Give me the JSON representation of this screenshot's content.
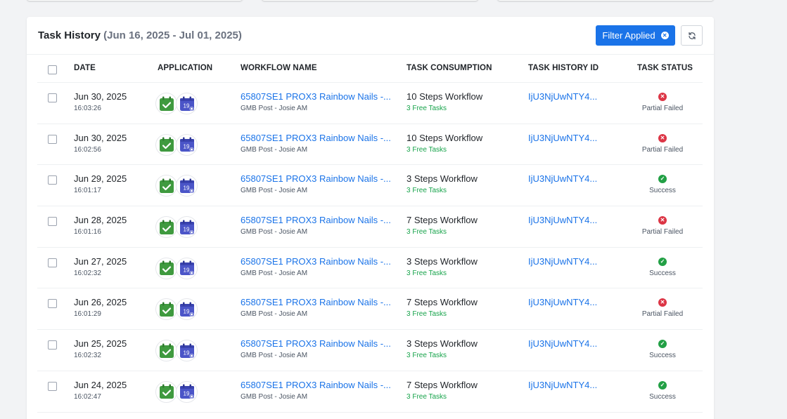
{
  "header": {
    "title": "Task History",
    "date_range": "(Jun 16, 2025 - Jul 01, 2025)",
    "filter_label": "Filter Applied"
  },
  "columns": {
    "date": "DATE",
    "application": "APPLICATION",
    "workflow_name": "WORKFLOW NAME",
    "task_consumption": "TASK CONSUMPTION",
    "task_history_id": "TASK HISTORY ID",
    "task_status": "TASK STATUS"
  },
  "colors": {
    "accent": "#1a73e8",
    "success": "#22a045",
    "failed": "#dc3545",
    "free_tasks": "#16a34a",
    "app_green": "#3f9a3f",
    "app_indigo": "#4b55c8"
  },
  "icons": [
    "close-circle-icon",
    "refresh-icon",
    "calendar-check-icon",
    "calendar-day-icon",
    "fail-x-icon",
    "success-check-icon"
  ],
  "rows": [
    {
      "date": "Jun 30, 2025",
      "time": "16:03:26",
      "workflow": "65807SE1 PROX3 Rainbow Nails -...",
      "workflow_sub": "GMB Post - Josie AM",
      "consumption": "10 Steps Workflow",
      "free": "3 Free Tasks",
      "history_id": "IjU3NjUwNTY4...",
      "status": "Partial Failed",
      "ok": false,
      "cal_day": "19"
    },
    {
      "date": "Jun 30, 2025",
      "time": "16:02:56",
      "workflow": "65807SE1 PROX3 Rainbow Nails -...",
      "workflow_sub": "GMB Post - Josie AM",
      "consumption": "10 Steps Workflow",
      "free": "3 Free Tasks",
      "history_id": "IjU3NjUwNTY4...",
      "status": "Partial Failed",
      "ok": false,
      "cal_day": "19"
    },
    {
      "date": "Jun 29, 2025",
      "time": "16:01:17",
      "workflow": "65807SE1 PROX3 Rainbow Nails -...",
      "workflow_sub": "GMB Post - Josie AM",
      "consumption": "3 Steps Workflow",
      "free": "3 Free Tasks",
      "history_id": "IjU3NjUwNTY4...",
      "status": "Success",
      "ok": true,
      "cal_day": "19"
    },
    {
      "date": "Jun 28, 2025",
      "time": "16:01:16",
      "workflow": "65807SE1 PROX3 Rainbow Nails -...",
      "workflow_sub": "GMB Post - Josie AM",
      "consumption": "7 Steps Workflow",
      "free": "3 Free Tasks",
      "history_id": "IjU3NjUwNTY4...",
      "status": "Partial Failed",
      "ok": false,
      "cal_day": "19"
    },
    {
      "date": "Jun 27, 2025",
      "time": "16:02:32",
      "workflow": "65807SE1 PROX3 Rainbow Nails -...",
      "workflow_sub": "GMB Post - Josie AM",
      "consumption": "3 Steps Workflow",
      "free": "3 Free Tasks",
      "history_id": "IjU3NjUwNTY4...",
      "status": "Success",
      "ok": true,
      "cal_day": "19"
    },
    {
      "date": "Jun 26, 2025",
      "time": "16:01:29",
      "workflow": "65807SE1 PROX3 Rainbow Nails -...",
      "workflow_sub": "GMB Post - Josie AM",
      "consumption": "7 Steps Workflow",
      "free": "3 Free Tasks",
      "history_id": "IjU3NjUwNTY4...",
      "status": "Partial Failed",
      "ok": false,
      "cal_day": "19"
    },
    {
      "date": "Jun 25, 2025",
      "time": "16:02:32",
      "workflow": "65807SE1 PROX3 Rainbow Nails -...",
      "workflow_sub": "GMB Post - Josie AM",
      "consumption": "3 Steps Workflow",
      "free": "3 Free Tasks",
      "history_id": "IjU3NjUwNTY4...",
      "status": "Success",
      "ok": true,
      "cal_day": "19"
    },
    {
      "date": "Jun 24, 2025",
      "time": "16:02:47",
      "workflow": "65807SE1 PROX3 Rainbow Nails -...",
      "workflow_sub": "GMB Post - Josie AM",
      "consumption": "7 Steps Workflow",
      "free": "3 Free Tasks",
      "history_id": "IjU3NjUwNTY4...",
      "status": "Success",
      "ok": true,
      "cal_day": "19"
    }
  ]
}
